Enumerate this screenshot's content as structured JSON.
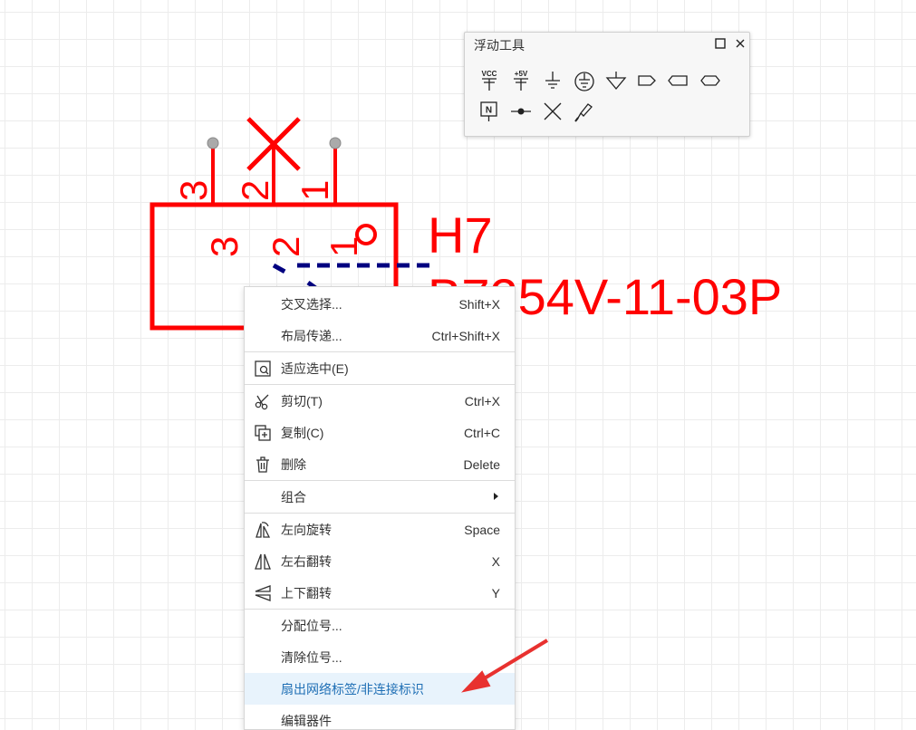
{
  "component": {
    "designator": "H7",
    "part_number": "B7254V-11-03P",
    "pin_numbers_outside": [
      "3",
      "2",
      "1"
    ],
    "pin_numbers_inside": [
      "3",
      "2",
      "1"
    ],
    "color": "#ff0000",
    "wire_color": "#000080"
  },
  "float_tool": {
    "title": "浮动工具",
    "tools_row1": [
      {
        "name": "vcc-icon",
        "text": "VCC"
      },
      {
        "name": "plus5v-icon",
        "text": "+5V"
      },
      {
        "name": "ground-icon"
      },
      {
        "name": "earth-icon"
      },
      {
        "name": "analog-ground-icon"
      },
      {
        "name": "net-port-out-icon"
      },
      {
        "name": "net-port-in-icon"
      },
      {
        "name": "net-port-bidir-icon"
      }
    ],
    "tools_row2": [
      {
        "name": "net-label-icon",
        "text": "N"
      },
      {
        "name": "junction-icon"
      },
      {
        "name": "no-connect-icon"
      },
      {
        "name": "probe-icon"
      }
    ]
  },
  "context_menu": {
    "items": [
      {
        "id": "cross-select",
        "label": "交叉选择...",
        "shortcut": "Shift+X",
        "icon": ""
      },
      {
        "id": "layout-transfer",
        "label": "布局传递...",
        "shortcut": "Ctrl+Shift+X",
        "icon": ""
      },
      {
        "id": "fit-selection",
        "label": "适应选中(E)",
        "shortcut": "",
        "icon": "fit-selection-icon"
      },
      {
        "id": "cut",
        "label": "剪切(T)",
        "shortcut": "Ctrl+X",
        "icon": "scissors-icon"
      },
      {
        "id": "copy",
        "label": "复制(C)",
        "shortcut": "Ctrl+C",
        "icon": "copy-icon"
      },
      {
        "id": "delete",
        "label": "删除",
        "shortcut": "Delete",
        "icon": "trash-icon"
      },
      {
        "id": "group",
        "label": "组合",
        "shortcut": "",
        "icon": "",
        "submenu": true
      },
      {
        "id": "rotate-left",
        "label": "左向旋转",
        "shortcut": "Space",
        "icon": "rotate-left-icon"
      },
      {
        "id": "flip-horizontal",
        "label": "左右翻转",
        "shortcut": "X",
        "icon": "flip-horizontal-icon"
      },
      {
        "id": "flip-vertical",
        "label": "上下翻转",
        "shortcut": "Y",
        "icon": "flip-vertical-icon"
      },
      {
        "id": "assign-designator",
        "label": "分配位号...",
        "shortcut": "",
        "icon": ""
      },
      {
        "id": "clear-designator",
        "label": "清除位号...",
        "shortcut": "",
        "icon": ""
      },
      {
        "id": "fanout-net-labels",
        "label": "扇出网络标签/非连接标识",
        "shortcut": "",
        "icon": "",
        "active": true
      },
      {
        "id": "edit-component",
        "label": "编辑器件",
        "shortcut": "",
        "icon": ""
      }
    ]
  },
  "annotation": {
    "arrow_color": "#e8312f"
  }
}
